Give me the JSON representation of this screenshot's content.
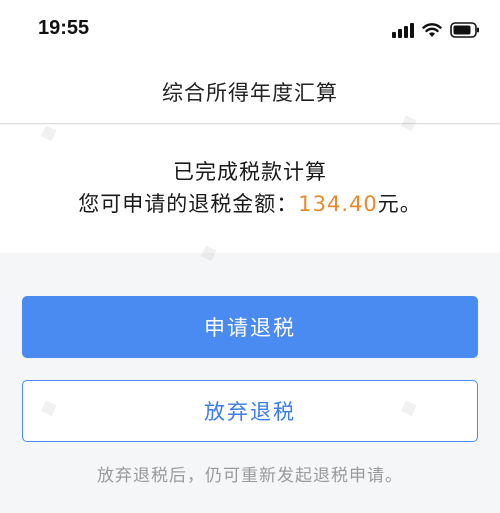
{
  "status_bar": {
    "time": "19:55",
    "icons": [
      "signal-icon",
      "wifi-icon",
      "battery-icon"
    ]
  },
  "nav": {
    "title": "综合所得年度汇算"
  },
  "result": {
    "line1": "已完成税款计算",
    "line2_prefix": "您可申请的退税金额：",
    "amount": "134.40",
    "currency": "元。"
  },
  "actions": {
    "apply_label": "申请退税",
    "abandon_label": "放弃退税"
  },
  "hint": "放弃退税后，仍可重新发起退税申请。",
  "colors": {
    "primary": "#4a8bf2",
    "amount": "#e88a2a",
    "background": "#f5f6f8"
  }
}
